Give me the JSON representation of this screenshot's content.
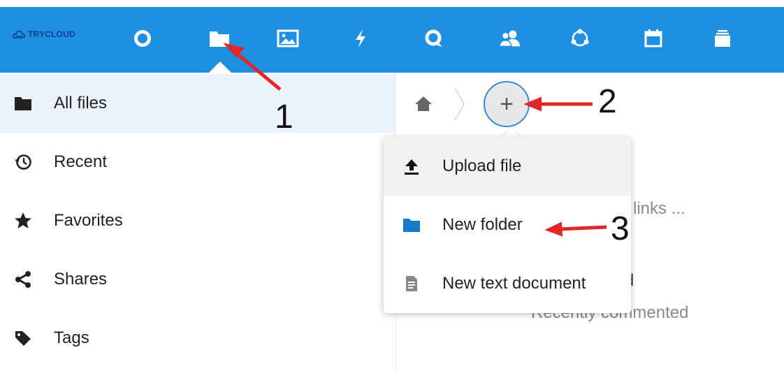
{
  "brand": {
    "name": "TRYCLOUD",
    "color": "#0b3d91"
  },
  "topbar": {
    "color": "#1e8fe1",
    "apps": [
      {
        "icon": "dashboard-circle-icon"
      },
      {
        "icon": "files-folder-icon",
        "active": true
      },
      {
        "icon": "photos-icon"
      },
      {
        "icon": "activity-bolt-icon"
      },
      {
        "icon": "search-talk-icon"
      },
      {
        "icon": "contacts-icon"
      },
      {
        "icon": "circles-icon"
      },
      {
        "icon": "calendar-icon"
      },
      {
        "icon": "deck-stack-icon"
      }
    ]
  },
  "sidebar": {
    "items": [
      {
        "label": "All files",
        "icon": "folder-icon",
        "active": true
      },
      {
        "label": "Recent",
        "icon": "history-icon"
      },
      {
        "label": "Favorites",
        "icon": "star-icon"
      },
      {
        "label": "Shares",
        "icon": "share-icon"
      },
      {
        "label": "Tags",
        "icon": "tag-icon"
      }
    ]
  },
  "breadcrumb": {
    "home_icon": "home-icon",
    "add_label": "+"
  },
  "new_menu": {
    "items": [
      {
        "label": "Upload file",
        "icon": "upload-icon"
      },
      {
        "label": "New folder",
        "icon": "folder-icon"
      },
      {
        "label": "New text document",
        "icon": "text-document-icon"
      }
    ]
  },
  "background_content": {
    "links_text": "links ...",
    "d_text": "d",
    "recently_commented": "Recently commented"
  },
  "annotations": {
    "labels": [
      "1",
      "2",
      "3"
    ],
    "arrow_color": "#e02828"
  }
}
